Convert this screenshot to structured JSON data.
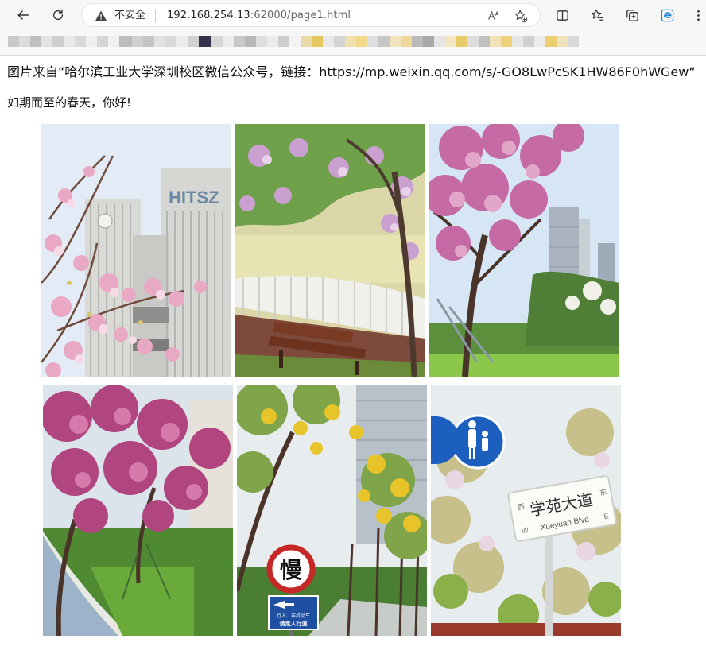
{
  "browser": {
    "security_label": "不安全",
    "url_host": "192.168.254.13",
    "url_rest": ":62000/page1.html",
    "icons": {
      "back": "arrow-left-icon",
      "refresh": "refresh-icon",
      "warning": "warning-triangle-icon",
      "read_aloud": "read-aloud-icon",
      "add_favorite": "star-plus-icon",
      "split_screen": "split-screen-icon",
      "favorites": "favorites-list-icon",
      "collections": "collections-icon",
      "edge": "edge-icon"
    }
  },
  "page": {
    "source_line": "图片来自“哈尔滨工业大学深圳校区微信公众号，链接：https://mp.weixin.qq.com/s/-GO8LwPcSK1HW86F0hWGew“",
    "greeting": "如期而至的春天，你好!"
  },
  "photos": {
    "photo1": {
      "sign_text": "HITSZ"
    },
    "photo5": {
      "slow_sign": "慢",
      "ped_sign_line1": "行人、非机动车",
      "ped_sign_line2": "请走人行道"
    },
    "photo6": {
      "street_sign_cn": "学苑大道",
      "street_sign_en": "Xueyuan Blvd",
      "street_sign_w": "W",
      "street_sign_e": "E",
      "street_sign_xi": "西",
      "street_sign_dong": "东"
    }
  },
  "colors": {
    "accent_pink": "#d88ab6",
    "accent_magenta": "#b0457f",
    "accent_yellow": "#e6c42a",
    "sky": "#dce9f5",
    "grass": "#7fbf3e"
  }
}
